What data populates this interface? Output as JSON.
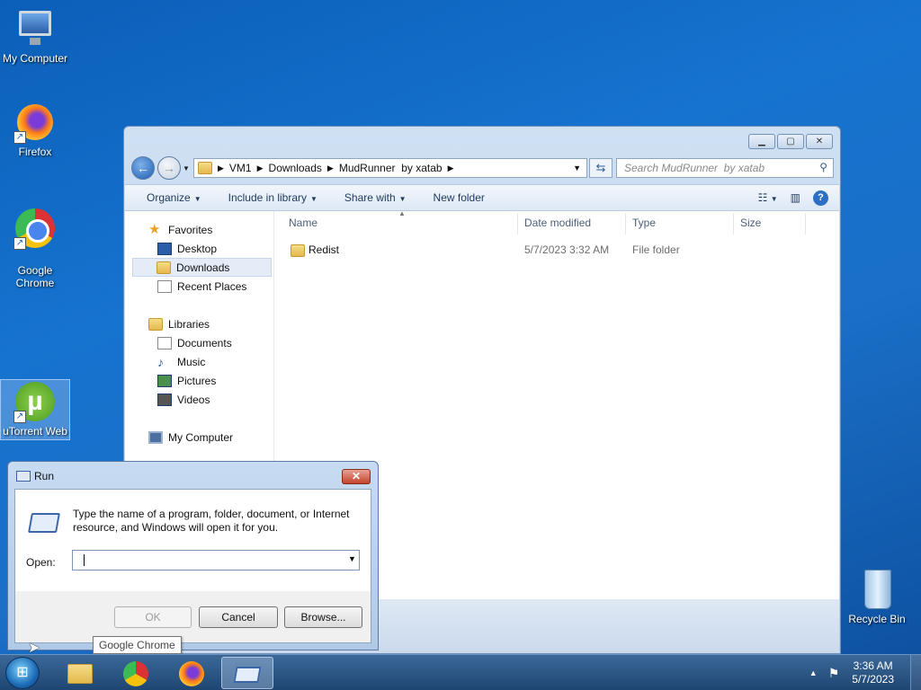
{
  "desktop": {
    "icons": [
      {
        "label": "My Computer"
      },
      {
        "label": "Firefox"
      },
      {
        "label": "Google\nChrome"
      },
      {
        "label": "uTorrent Web"
      },
      {
        "label": "Recycle Bin"
      }
    ]
  },
  "explorer": {
    "breadcrumb": [
      "VM1",
      "Downloads",
      "MudRunner  by xatab"
    ],
    "search_placeholder": "Search MudRunner  by xatab",
    "toolbar": {
      "organize": "Organize",
      "include_in_library": "Include in library",
      "share_with": "Share with",
      "new_folder": "New folder"
    },
    "nav": {
      "favorites": "Favorites",
      "desktop": "Desktop",
      "downloads": "Downloads",
      "recent_places": "Recent Places",
      "libraries": "Libraries",
      "documents": "Documents",
      "music": "Music",
      "pictures": "Pictures",
      "videos": "Videos",
      "my_computer": "My Computer"
    },
    "columns": {
      "name": "Name",
      "date_modified": "Date modified",
      "type": "Type",
      "size": "Size"
    },
    "files": [
      {
        "name": "Redist",
        "date_modified": "5/7/2023 3:32 AM",
        "type": "File folder",
        "size": ""
      }
    ]
  },
  "run_dialog": {
    "title": "Run",
    "description": "Type the name of a program, folder, document, or Internet resource, and Windows will open it for you.",
    "open_label": "Open:",
    "open_value": "",
    "ok": "OK",
    "cancel": "Cancel",
    "browse": "Browse..."
  },
  "tooltip": "Google Chrome",
  "taskbar": {
    "time": "3:36 AM",
    "date": "5/7/2023"
  },
  "colors": {
    "desktop_bg": "#1673cf",
    "taskbar": "#2a5585",
    "selection": "#e3ecf7"
  }
}
